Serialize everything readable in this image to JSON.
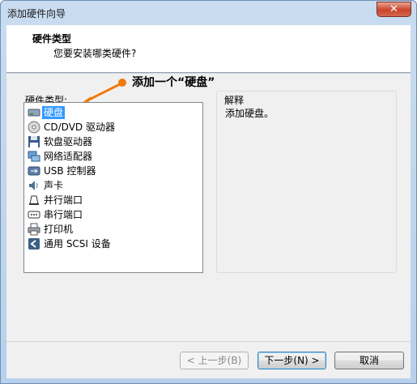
{
  "window": {
    "title": "添加硬件向导",
    "close_glyph": "✕"
  },
  "header": {
    "title": "硬件类型",
    "subtitle": "您要安装哪类硬件?"
  },
  "annotation": {
    "text": "添加一个“硬盘”",
    "color": "#f07a0a"
  },
  "list": {
    "label": "硬件类型:",
    "items": [
      {
        "label": "硬盘",
        "icon": "hard-disk-icon",
        "selected": true
      },
      {
        "label": "CD/DVD 驱动器",
        "icon": "cd-dvd-icon"
      },
      {
        "label": "软盘驱动器",
        "icon": "floppy-icon"
      },
      {
        "label": "网络适配器",
        "icon": "network-adapter-icon"
      },
      {
        "label": "USB 控制器",
        "icon": "usb-icon"
      },
      {
        "label": "声卡",
        "icon": "sound-card-icon"
      },
      {
        "label": "并行端口",
        "icon": "parallel-port-icon"
      },
      {
        "label": "串行端口",
        "icon": "serial-port-icon"
      },
      {
        "label": "打印机",
        "icon": "printer-icon"
      },
      {
        "label": "通用 SCSI 设备",
        "icon": "scsi-icon"
      }
    ]
  },
  "description": {
    "label": "解释",
    "text": "添加硬盘。"
  },
  "buttons": {
    "back": "< 上一步(B)",
    "next": "下一步(N) >",
    "cancel": "取消"
  },
  "colors": {
    "selection": "#3399ff",
    "titlebar": "#c9dcf0",
    "close": "#c9442c"
  }
}
